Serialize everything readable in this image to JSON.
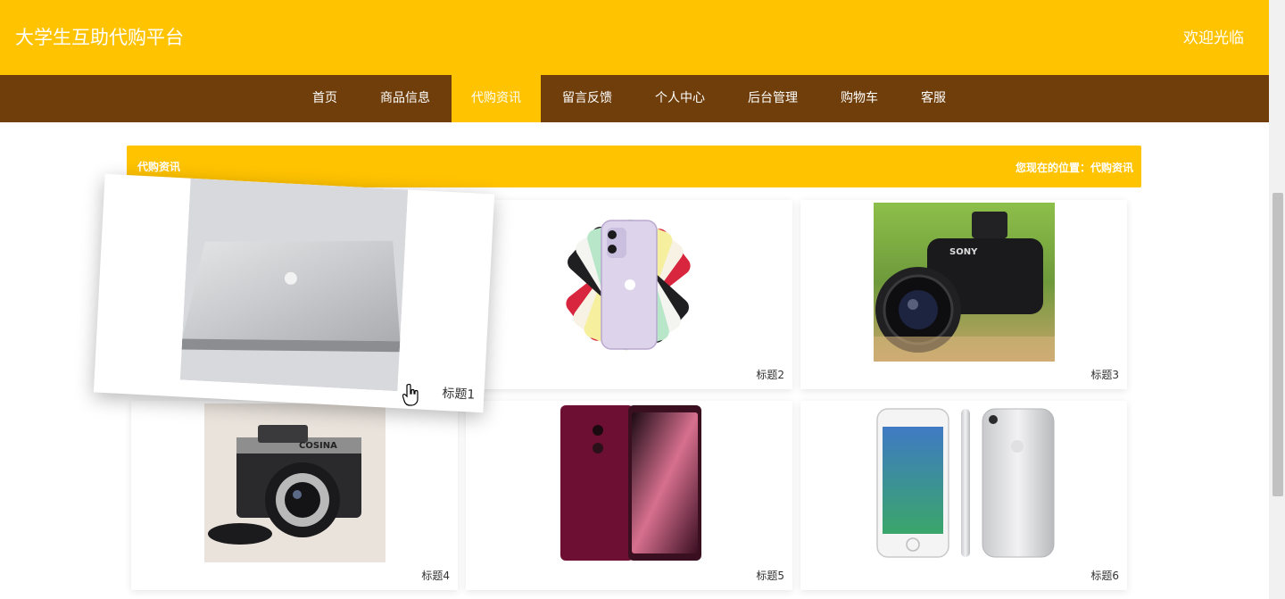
{
  "header": {
    "site_title": "大学生互助代购平台",
    "welcome": "欢迎光临"
  },
  "nav": {
    "items": [
      {
        "label": "首页"
      },
      {
        "label": "商品信息"
      },
      {
        "label": "代购资讯",
        "active": true
      },
      {
        "label": "留言反馈"
      },
      {
        "label": "个人中心"
      },
      {
        "label": "后台管理"
      },
      {
        "label": "购物车"
      },
      {
        "label": "客服"
      }
    ]
  },
  "section": {
    "title": "代购资讯",
    "breadcrumb": "您现在的位置：代购资讯"
  },
  "cards": [
    {
      "caption": "标题1",
      "image": "laptop-image"
    },
    {
      "caption": "标题2",
      "image": "smartphone-fan-image"
    },
    {
      "caption": "标题3",
      "image": "bridge-camera-image",
      "brand": "SONY"
    },
    {
      "caption": "标题4",
      "image": "film-camera-image",
      "brand": "COSINA"
    },
    {
      "caption": "标题5",
      "image": "smartphone-red-image"
    },
    {
      "caption": "标题6",
      "image": "smartphone-white-image"
    }
  ],
  "colors": {
    "header_bg": "#ffc300",
    "nav_bg": "#6f3e0a",
    "nav_active_bg": "#ffc300"
  }
}
